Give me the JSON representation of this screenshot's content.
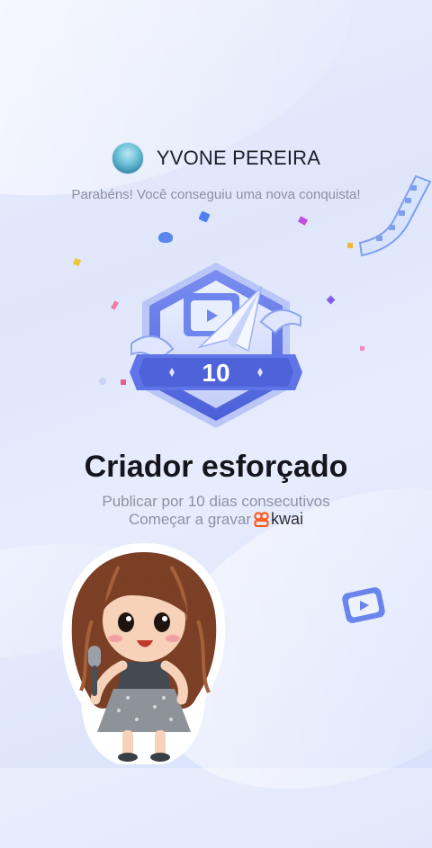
{
  "user": {
    "name": "YVONE PEREIRA"
  },
  "header": {
    "congrats": "Parabéns! Você conseguiu uma nova conquista!"
  },
  "badge": {
    "number": "10"
  },
  "achievement": {
    "title": "Criador esforçado",
    "description": "Publicar por 10 dias consecutivos",
    "cta_text": "Começar a gravar",
    "app_name": "kwai"
  },
  "colors": {
    "badge_primary": "#5b6fe0",
    "badge_light": "#9fb0f5",
    "kwai_orange": "#ff5a1f",
    "title_text": "#15161c",
    "muted_text": "#8d91a3"
  },
  "icons": [
    "avatar-photo",
    "achievement-badge-icon",
    "film-strip-icon",
    "kwai-logo-icon",
    "video-play-icon",
    "character-sticker"
  ]
}
